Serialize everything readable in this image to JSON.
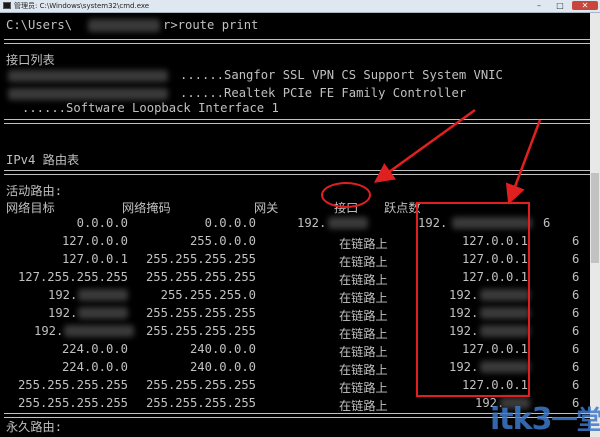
{
  "window": {
    "title": "管理员: C:\\Windows\\system32\\cmd.exe"
  },
  "prompt": {
    "prefix": "C:\\Users\\",
    "suffix": "r>route print"
  },
  "interfaces": {
    "title": "接口列表",
    "items": [
      {
        "name": "......Sangfor SSL VPN CS Support System VNIC"
      },
      {
        "name": "......Realtek PCIe FE Family Controller"
      },
      {
        "name": "......Software Loopback Interface 1"
      }
    ]
  },
  "ipv4": {
    "title": "IPv4 路由表",
    "active_routes": "活动路由:",
    "headers": [
      "网络目标",
      "网络掩码",
      "网关",
      "接口",
      "跃点数"
    ],
    "rows": [
      [
        "0.0.0.0",
        "0.0.0.0",
        "192.",
        "192.",
        "6"
      ],
      [
        "127.0.0.0",
        "255.0.0.0",
        "在链路上",
        "127.0.0.1",
        "6"
      ],
      [
        "127.0.0.1",
        "255.255.255.255",
        "在链路上",
        "127.0.0.1",
        "6"
      ],
      [
        "127.255.255.255",
        "255.255.255.255",
        "在链路上",
        "127.0.0.1",
        "6"
      ],
      [
        "192.",
        "255.255.255.0",
        "在链路上",
        "192.",
        "6"
      ],
      [
        "192.",
        "255.255.255.255",
        "在链路上",
        "192.",
        "6"
      ],
      [
        "192.",
        "255.255.255.255",
        "在链路上",
        "192.",
        "6"
      ],
      [
        "224.0.0.0",
        "240.0.0.0",
        "在链路上",
        "127.0.0.1",
        "6"
      ],
      [
        "224.0.0.0",
        "240.0.0.0",
        "在链路上",
        "192.",
        "6"
      ],
      [
        "255.255.255.255",
        "255.255.255.255",
        "在链路上",
        "127.0.0.1",
        "6"
      ],
      [
        "255.255.255.255",
        "255.255.255.255",
        "在链路上",
        "192.",
        "6"
      ]
    ]
  },
  "persistent_routes": "永久路由:",
  "annotation": {
    "color": "#e02020"
  },
  "watermark": {
    "latin": "itk3",
    "cn": "一堂课",
    "color": "#3c78c8"
  }
}
